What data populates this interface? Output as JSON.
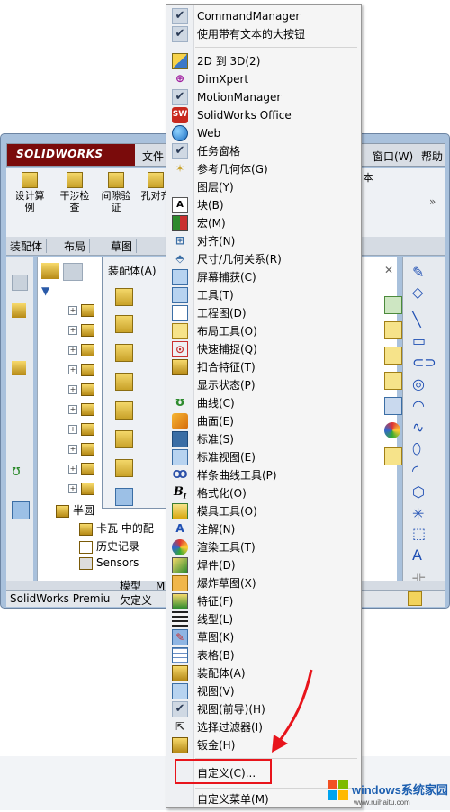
{
  "sw_window": {
    "logo": "SOLIDWORKS",
    "menu_file": "文件",
    "menu_window": "窗口(W)",
    "menu_help": "帮助",
    "toolbar": [
      {
        "label": "设计算例"
      },
      {
        "label": "干涉检查"
      },
      {
        "label": "间隙验证"
      },
      {
        "label": "孔对齐"
      },
      {
        "label": "本"
      }
    ],
    "cm_tabs": [
      "装配体",
      "布局",
      "草图"
    ],
    "assembly_panel_title": "装配体(A)",
    "tree_items": [
      "半圆",
      "卡瓦 中的配",
      "历史记录",
      "Sensors"
    ],
    "bottom_tabs": [
      "模型",
      "M"
    ],
    "status_left": "SolidWorks Premiu",
    "status_mid": "欠定义"
  },
  "context_menu": {
    "items": [
      {
        "label": "CommandManager",
        "icon": "check",
        "checked": true
      },
      {
        "label": "使用带有文本的大按钮",
        "icon": "check",
        "checked": true
      },
      {
        "label": "2D 到 3D(2)",
        "icon": "2d-to-3d-icon"
      },
      {
        "label": "DimXpert",
        "icon": "dimxpert-icon"
      },
      {
        "label": "MotionManager",
        "icon": "check",
        "checked": true
      },
      {
        "label": "SolidWorks Office",
        "icon": "sw-office-icon"
      },
      {
        "label": "Web",
        "icon": "web-globe-icon"
      },
      {
        "label": "任务窗格",
        "icon": "check",
        "checked": true
      },
      {
        "label": "参考几何体(G)",
        "icon": "reference-geometry-icon"
      },
      {
        "label": "图层(Y)",
        "icon": "layer-icon"
      },
      {
        "label": "块(B)",
        "icon": "block-icon"
      },
      {
        "label": "宏(M)",
        "icon": "macro-icon"
      },
      {
        "label": "对齐(N)",
        "icon": "align-icon"
      },
      {
        "label": "尺寸/几何关系(R)",
        "icon": "dimension-icon"
      },
      {
        "label": "屏幕捕获(C)",
        "icon": "screen-capture-icon"
      },
      {
        "label": "工具(T)",
        "icon": "tools-icon"
      },
      {
        "label": "工程图(D)",
        "icon": "drawing-icon"
      },
      {
        "label": "布局工具(O)",
        "icon": "layout-tools-icon"
      },
      {
        "label": "快速捕捉(Q)",
        "icon": "quick-snap-icon"
      },
      {
        "label": "扣合特征(T)",
        "icon": "fastening-feature-icon"
      },
      {
        "label": "显示状态(P)",
        "icon": "display-state-icon"
      },
      {
        "label": "曲线(C)",
        "icon": "curve-icon"
      },
      {
        "label": "曲面(E)",
        "icon": "surface-icon"
      },
      {
        "label": "标准(S)",
        "icon": "standard-icon"
      },
      {
        "label": "标准视图(E)",
        "icon": "standard-views-icon"
      },
      {
        "label": "样条曲线工具(P)",
        "icon": "spline-tools-icon"
      },
      {
        "label": "格式化(O)",
        "icon": "format-icon"
      },
      {
        "label": "模具工具(O)",
        "icon": "mold-tools-icon"
      },
      {
        "label": "注解(N)",
        "icon": "annotation-icon"
      },
      {
        "label": "渲染工具(T)",
        "icon": "render-tools-icon"
      },
      {
        "label": "焊件(D)",
        "icon": "weldment-icon"
      },
      {
        "label": "爆炸草图(X)",
        "icon": "explode-sketch-icon"
      },
      {
        "label": "特征(F)",
        "icon": "features-icon"
      },
      {
        "label": "线型(L)",
        "icon": "line-format-icon"
      },
      {
        "label": "草图(K)",
        "icon": "sketch-icon"
      },
      {
        "label": "表格(B)",
        "icon": "table-icon"
      },
      {
        "label": "装配体(A)",
        "icon": "assembly-icon"
      },
      {
        "label": "视图(V)",
        "icon": "view-icon"
      },
      {
        "label": "视图(前导)(H)",
        "icon": "check",
        "checked": true
      },
      {
        "label": "选择过滤器(I)",
        "icon": "selection-filter-icon"
      },
      {
        "label": "钣金(H)",
        "icon": "sheet-metal-icon"
      }
    ],
    "customize": "自定义(C)...",
    "customize_menu": "自定义菜单(M)"
  },
  "watermark": {
    "brand": "windows系统家园",
    "url": "www.ruihaitu.com"
  },
  "colors": {
    "highlight": "#e8141b",
    "sw_red": "#7a0b0b",
    "window_blue": "#a9c1dc"
  }
}
